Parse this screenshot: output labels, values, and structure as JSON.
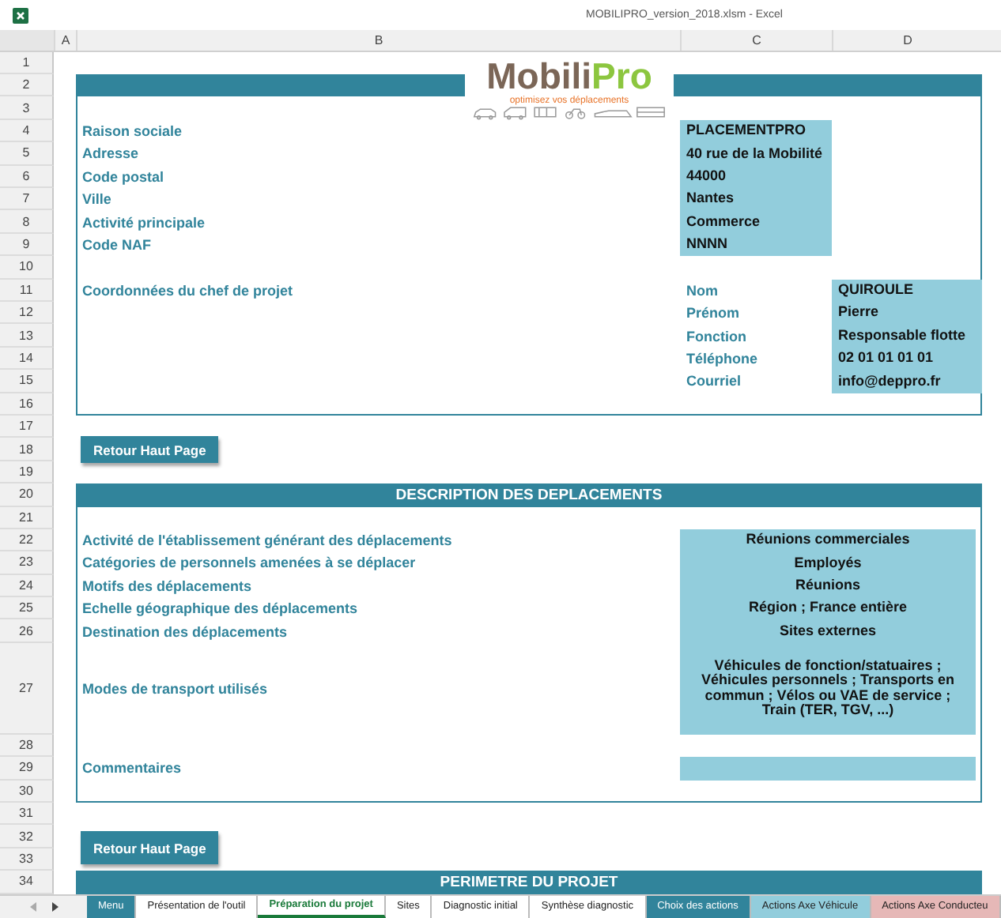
{
  "window": {
    "title": "MOBILIPRO_version_2018.xlsm - Excel"
  },
  "columns": [
    "A",
    "B",
    "C",
    "D"
  ],
  "row_numbers": [
    "1",
    "2",
    "3",
    "4",
    "5",
    "6",
    "7",
    "8",
    "9",
    "10",
    "11",
    "12",
    "13",
    "14",
    "15",
    "16",
    "17",
    "18",
    "19",
    "20",
    "21",
    "22",
    "23",
    "24",
    "25",
    "26",
    "27",
    "28",
    "29",
    "30",
    "31",
    "32",
    "33",
    "34"
  ],
  "logo": {
    "name_start": "Mobili",
    "name_end": "Pro",
    "tagline": "optimisez vos déplacements"
  },
  "company": [
    {
      "label": "Raison sociale",
      "value": "PLACEMENTPRO"
    },
    {
      "label": "Adresse",
      "value": "40 rue de la Mobilité"
    },
    {
      "label": "Code postal",
      "value": "44000"
    },
    {
      "label": "Ville",
      "value": "Nantes"
    },
    {
      "label": "Activité principale",
      "value": "Commerce"
    },
    {
      "label": "Code NAF",
      "value": "NNNN"
    }
  ],
  "project_lead": {
    "label": "Coordonnées du chef de projet",
    "fields": [
      {
        "label": "Nom",
        "value": "QUIROULE"
      },
      {
        "label": "Prénom",
        "value": "Pierre"
      },
      {
        "label": "Fonction",
        "value": "Responsable flotte"
      },
      {
        "label": "Téléphone",
        "value": "02 01 01 01 01"
      },
      {
        "label": "Courriel",
        "value": "info@deppro.fr"
      }
    ]
  },
  "buttons": [
    "Retour Haut Page",
    "Retour Haut Page"
  ],
  "sections": [
    "DESCRIPTION DES DEPLACEMENTS",
    "PERIMETRE DU PROJET"
  ],
  "description": [
    {
      "label": "Activité de l'établissement générant des déplacements",
      "value": "Réunions commerciales"
    },
    {
      "label": "Catégories de personnels amenées à se déplacer",
      "value": "Employés"
    },
    {
      "label": "Motifs des déplacements",
      "value": "Réunions"
    },
    {
      "label": "Echelle géographique des déplacements",
      "value": "Région ; France entière"
    },
    {
      "label": "Destination des déplacements",
      "value": "Sites externes"
    },
    {
      "label": "Modes de transport utilisés",
      "value": "Véhicules de fonction/statuaires ; Véhicules personnels ; Transports en commun ; Vélos ou VAE de service ; Train (TER, TGV, ...)"
    }
  ],
  "comments": {
    "label": "Commentaires"
  },
  "sheet_tabs": [
    {
      "label": "Menu",
      "selected": false,
      "color": "#31849b"
    },
    {
      "label": "Présentation de l'outil",
      "selected": false,
      "color": "#ffffff"
    },
    {
      "label": "Préparation du projet",
      "selected": true,
      "color": "#ffffff"
    },
    {
      "label": "Sites",
      "selected": false,
      "color": "#ffffff"
    },
    {
      "label": "Diagnostic initial",
      "selected": false,
      "color": "#ffffff"
    },
    {
      "label": "Synthèse diagnostic",
      "selected": false,
      "color": "#ffffff"
    },
    {
      "label": "Choix des actions",
      "selected": false,
      "color": "#31849b"
    },
    {
      "label": "Actions Axe Véhicule",
      "selected": false,
      "color": "#92cddc"
    },
    {
      "label": "Actions Axe Conducteu",
      "selected": false,
      "color": "#e6b8b7"
    }
  ]
}
